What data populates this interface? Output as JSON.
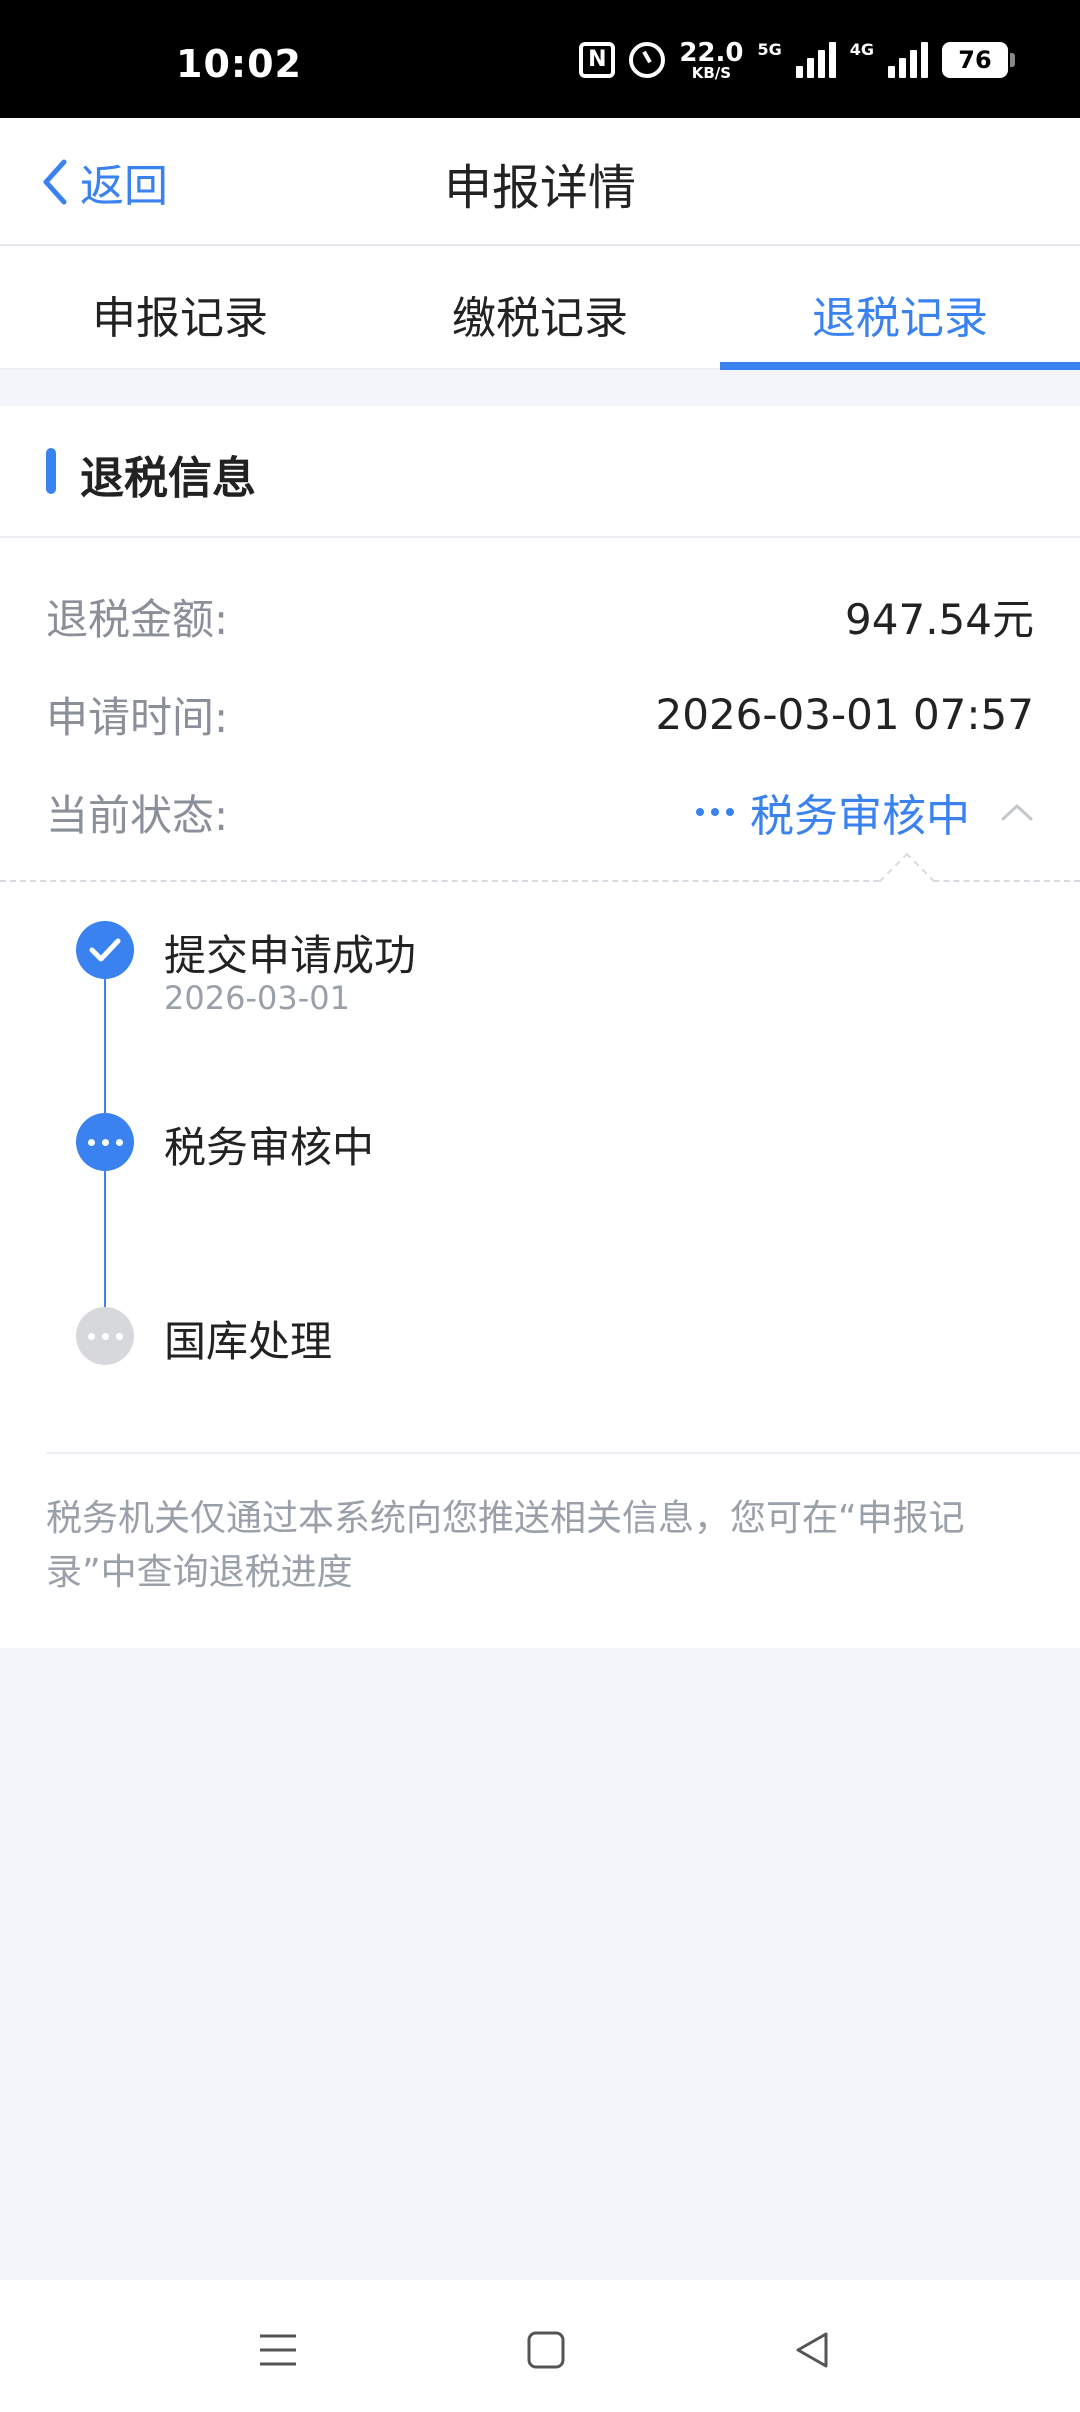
{
  "status_bar": {
    "time": "10:02",
    "nfc_label": "N",
    "net_speed_value": "22.0",
    "net_speed_unit": "KB/S",
    "signal1_label": "5G",
    "signal2_label": "4G",
    "battery": "76",
    "icons": [
      "nfc-icon",
      "alarm-icon",
      "signal-icon",
      "battery-icon"
    ]
  },
  "nav": {
    "back_label": "返回",
    "title": "申报详情"
  },
  "tabs": [
    {
      "label": "申报记录",
      "active": false
    },
    {
      "label": "缴税记录",
      "active": false
    },
    {
      "label": "退税记录",
      "active": true
    }
  ],
  "section": {
    "title": "退税信息",
    "rows": [
      {
        "label": "退税金额:",
        "value": "947.54元"
      },
      {
        "label": "申请时间:",
        "value": "2026-03-01 07:57"
      },
      {
        "label": "当前状态:",
        "value": "税务审核中"
      }
    ]
  },
  "timeline": [
    {
      "title": "提交申请成功",
      "date": "2026-03-01",
      "state": "done"
    },
    {
      "title": "税务审核中",
      "date": "",
      "state": "current"
    },
    {
      "title": "国库处理",
      "date": "",
      "state": "pending"
    }
  ],
  "note": "税务机关仅通过本系统向您推送相关信息，您可在“申报记录”中查询退税进度",
  "colors": {
    "accent": "#3a82f0",
    "muted": "#9aa0aa",
    "background": "#f3f5fa"
  }
}
